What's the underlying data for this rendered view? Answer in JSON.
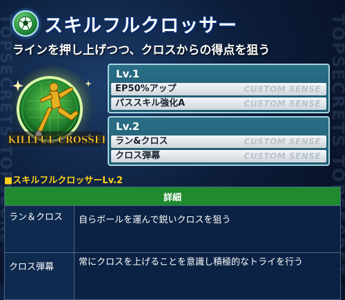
{
  "skill": {
    "title": "スキルフルクロッサー",
    "subtitle": "ラインを押し上げつつ、クロスからの得点を狙う",
    "badge_text": "SKILLFUL CROSSER"
  },
  "levels": [
    {
      "label": "Lv.1",
      "rows": [
        {
          "name": "EP50%アップ",
          "tag": "CUSTOM SENSE"
        },
        {
          "name": "パススキル強化A",
          "tag": "CUSTOM SENSE"
        }
      ]
    },
    {
      "label": "Lv.2",
      "rows": [
        {
          "name": "ラン&クロス",
          "tag": "CUSTOM SENSE"
        },
        {
          "name": "クロス弾幕",
          "tag": "CUSTOM SENSE"
        }
      ]
    }
  ],
  "detail": {
    "section_title": "■スキルフルクロッサーLv.2",
    "header": "詳細",
    "rows": [
      {
        "name": "ラン＆クロス",
        "desc": "自らボールを運んで鋭いクロスを狙う"
      },
      {
        "name": "クロス弾幕",
        "desc": "常にクロスを上げることを意識し積極的なトライを行う"
      }
    ]
  },
  "watermark": {
    "left": "TOPSECRETS TOPSECRETS TOP",
    "right": "TOPSECRETS TOPSECRETS TOP"
  },
  "colors": {
    "accent_green": "#1f8a2e",
    "section_yellow": "#ffd21a",
    "panel_teal": "#2a6f86"
  },
  "icons": {
    "header": "soccer-ball-icon",
    "badge": "player-kicking-icon"
  }
}
